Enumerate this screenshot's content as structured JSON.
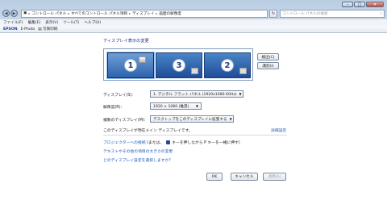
{
  "address_bar": {
    "segments": [
      "コントロール パネル",
      "すべてのコントロール パネル項目",
      "ディスプレイ",
      "画面の解像度"
    ],
    "search_placeholder": "コントロール パネルの検索"
  },
  "menu": [
    "ファイル(F)",
    "編集(E)",
    "表示(V)",
    "ツール(T)",
    "ヘルプ(H)"
  ],
  "toolbar": {
    "brand": "EPSON",
    "app": "E-Photo",
    "print_label": "写真印刷"
  },
  "section_heading": "ディスプレイ表示の変更",
  "monitors": [
    {
      "number": "1",
      "selected": true
    },
    {
      "number": "3",
      "selected": false
    },
    {
      "number": "2",
      "selected": false
    }
  ],
  "detect_button": "検出(C)",
  "identify_button": "識別(I)",
  "fields": {
    "display_label": "ディスプレイ(S):",
    "display_value": "1. デジタル フラット パネル (1920x1080 60Hz)",
    "resolution_label": "解像度(R):",
    "resolution_value": "1920 × 1080 (推奨)",
    "multi_label": "複数のディスプレイ(M):",
    "multi_value": "デスクトップをこのディスプレイに拡張する"
  },
  "main_display_text": "このディスプレイが現在メイン ディスプレイです。",
  "advanced_link": "詳細設定",
  "projector_link": "プロジェクターへの接続",
  "projector_text_a": "(または、",
  "projector_text_b": "キーを押しながら P キーを一緒に押す)",
  "text_size_link": "テキストやその他の項目の大きさの変更",
  "which_setting_link": "どのディスプレイ設定を選択しますか?",
  "buttons": {
    "ok": "OK",
    "cancel": "キャンセル",
    "apply": "適用(A)"
  }
}
